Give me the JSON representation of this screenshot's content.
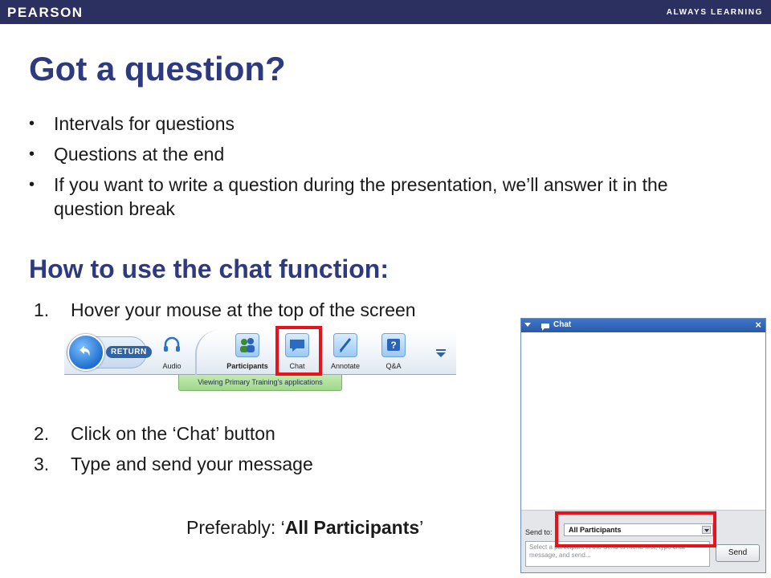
{
  "header": {
    "brand": "PEARSON",
    "tagline": "ALWAYS LEARNING",
    "background_color": "#2c3060"
  },
  "slide": {
    "title": "Got a question?",
    "bullets": [
      "Intervals for questions",
      "Questions at the end",
      "If you want to write a question during the presentation, we’ll answer it in the question break"
    ],
    "subtitle": "How to use the chat function:",
    "steps": [
      {
        "num": "1.",
        "text": "Hover your mouse at the top of the screen"
      },
      {
        "num": "2.",
        "text": "Click on the ‘Chat’ button"
      },
      {
        "num": "3.",
        "text": "Type and send your message"
      }
    ],
    "preferably_prefix": "Preferably: ‘",
    "preferably_bold": "All Participants",
    "preferably_suffix": "’",
    "heading_color": "#2e3a80",
    "highlight_color": "#e8121a"
  },
  "toolbar": {
    "return_label": "RETURN",
    "tools": [
      {
        "label": "Audio",
        "icon": "headset-icon"
      },
      {
        "label": "Participants",
        "icon": "participants-icon"
      },
      {
        "label": "Chat",
        "icon": "chat-bubble-icon"
      },
      {
        "label": "Annotate",
        "icon": "pen-icon"
      },
      {
        "label": "Q&A",
        "icon": "question-icon"
      }
    ],
    "viewing_text": "Viewing Primary Training's applications"
  },
  "chat_window": {
    "title": "Chat",
    "send_to_label": "Send to:",
    "send_to_value": "All Participants",
    "message_placeholder": "Select a participant in the Send to menu first, type chat message, and send...",
    "send_label": "Send"
  }
}
